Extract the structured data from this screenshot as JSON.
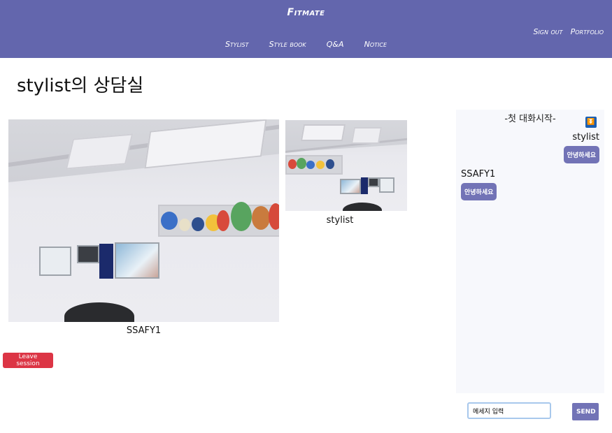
{
  "nav": {
    "brand": "Fitmate",
    "items": [
      "Stylist",
      "Style book",
      "Q&A",
      "Notice"
    ],
    "right": [
      "Sign out",
      "Portfolio"
    ]
  },
  "page": {
    "title": "stylist의 상담실"
  },
  "videos": {
    "main_caption": "SSAFY1",
    "sub_caption": "stylist"
  },
  "leave_label": "Leave session",
  "chat": {
    "header": "-첫 대화시작-",
    "messages": [
      {
        "sender": "stylist",
        "text": "안녕하세요",
        "side": "right"
      },
      {
        "sender": "SSAFY1",
        "text": "안녕하세요",
        "side": "left"
      }
    ],
    "input_value": "메세지 입력",
    "send_label": "SEND"
  },
  "colors": {
    "nav": "#6366ad",
    "bubble": "#7273b6",
    "leave": "#dc3545",
    "chat_bg": "#f7f8fc"
  }
}
